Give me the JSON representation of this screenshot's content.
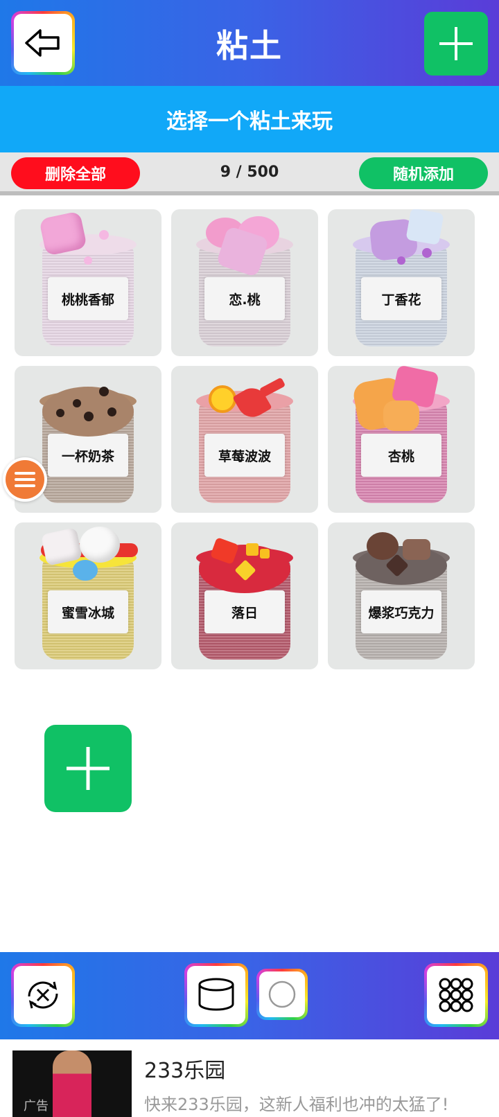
{
  "header": {
    "title": "粘土"
  },
  "subtitle": "选择一个粘土来玩",
  "actions": {
    "delete_all": "删除全部",
    "counter": "9 / 500",
    "random_add": "随机添加"
  },
  "slimes": [
    {
      "name": "桃桃香郁"
    },
    {
      "name": "恋.桃"
    },
    {
      "name": "丁香花"
    },
    {
      "name": "一杯奶茶"
    },
    {
      "name": "草莓波波"
    },
    {
      "name": "杏桃"
    },
    {
      "name": "蜜雪冰城"
    },
    {
      "name": "落日"
    },
    {
      "name": "爆浆巧克力"
    }
  ],
  "icons": {
    "back": "back-arrow-icon",
    "add": "plus-icon",
    "menu": "menu-icon",
    "reset": "reset-icon",
    "jar": "jar-icon",
    "circle": "circle-icon",
    "grid": "grid-icon"
  },
  "ad": {
    "title": "233乐园",
    "desc": "快来233乐园，这新人福利也冲的太猛了!",
    "tag": "广告"
  },
  "colors": {
    "primary_green": "#10c165",
    "danger_red": "#ff0d1d",
    "sky_blue": "#11a8f8"
  }
}
